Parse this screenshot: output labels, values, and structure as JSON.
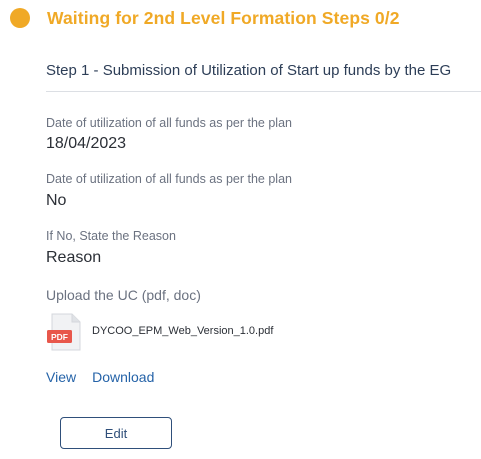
{
  "colors": {
    "status_accent": "#f0a926",
    "link": "#2563a8",
    "button_border": "#2f4f7a",
    "pdf_badge": "#e8574b"
  },
  "header": {
    "status_icon": "status-dot-icon",
    "title": "Waiting for 2nd Level Formation Steps 0/2"
  },
  "step": {
    "title": "Step 1 - Submission of Utilization of Start up funds by the EG"
  },
  "fields": [
    {
      "label": "Date of utilization of all funds as per the plan",
      "value": "18/04/2023"
    },
    {
      "label": "Date of utilization of all funds as per the plan",
      "value": "No"
    },
    {
      "label": "If No, State the Reason",
      "value": "Reason"
    }
  ],
  "upload": {
    "label": "Upload the UC (pdf, doc)",
    "file_icon": "pdf-file-icon",
    "file_type_badge": "PDF",
    "file_name": "DYCOO_EPM_Web_Version_1.0.pdf",
    "view_label": "View",
    "download_label": "Download"
  },
  "actions": {
    "edit_label": "Edit"
  }
}
